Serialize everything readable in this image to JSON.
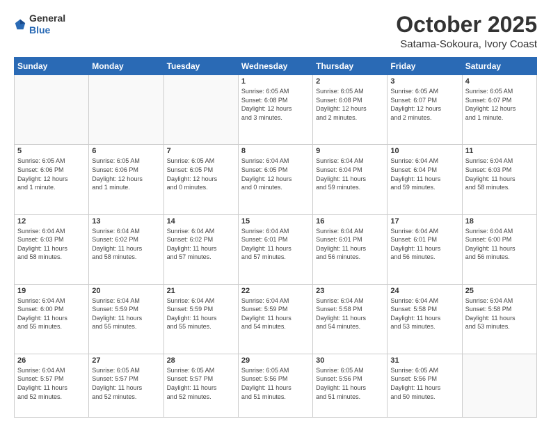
{
  "header": {
    "logo_general": "General",
    "logo_blue": "Blue",
    "month_title": "October 2025",
    "location": "Satama-Sokoura, Ivory Coast"
  },
  "days_of_week": [
    "Sunday",
    "Monday",
    "Tuesday",
    "Wednesday",
    "Thursday",
    "Friday",
    "Saturday"
  ],
  "weeks": [
    [
      {
        "day": "",
        "info": ""
      },
      {
        "day": "",
        "info": ""
      },
      {
        "day": "",
        "info": ""
      },
      {
        "day": "1",
        "info": "Sunrise: 6:05 AM\nSunset: 6:08 PM\nDaylight: 12 hours\nand 3 minutes."
      },
      {
        "day": "2",
        "info": "Sunrise: 6:05 AM\nSunset: 6:08 PM\nDaylight: 12 hours\nand 2 minutes."
      },
      {
        "day": "3",
        "info": "Sunrise: 6:05 AM\nSunset: 6:07 PM\nDaylight: 12 hours\nand 2 minutes."
      },
      {
        "day": "4",
        "info": "Sunrise: 6:05 AM\nSunset: 6:07 PM\nDaylight: 12 hours\nand 1 minute."
      }
    ],
    [
      {
        "day": "5",
        "info": "Sunrise: 6:05 AM\nSunset: 6:06 PM\nDaylight: 12 hours\nand 1 minute."
      },
      {
        "day": "6",
        "info": "Sunrise: 6:05 AM\nSunset: 6:06 PM\nDaylight: 12 hours\nand 1 minute."
      },
      {
        "day": "7",
        "info": "Sunrise: 6:05 AM\nSunset: 6:05 PM\nDaylight: 12 hours\nand 0 minutes."
      },
      {
        "day": "8",
        "info": "Sunrise: 6:04 AM\nSunset: 6:05 PM\nDaylight: 12 hours\nand 0 minutes."
      },
      {
        "day": "9",
        "info": "Sunrise: 6:04 AM\nSunset: 6:04 PM\nDaylight: 11 hours\nand 59 minutes."
      },
      {
        "day": "10",
        "info": "Sunrise: 6:04 AM\nSunset: 6:04 PM\nDaylight: 11 hours\nand 59 minutes."
      },
      {
        "day": "11",
        "info": "Sunrise: 6:04 AM\nSunset: 6:03 PM\nDaylight: 11 hours\nand 58 minutes."
      }
    ],
    [
      {
        "day": "12",
        "info": "Sunrise: 6:04 AM\nSunset: 6:03 PM\nDaylight: 11 hours\nand 58 minutes."
      },
      {
        "day": "13",
        "info": "Sunrise: 6:04 AM\nSunset: 6:02 PM\nDaylight: 11 hours\nand 58 minutes."
      },
      {
        "day": "14",
        "info": "Sunrise: 6:04 AM\nSunset: 6:02 PM\nDaylight: 11 hours\nand 57 minutes."
      },
      {
        "day": "15",
        "info": "Sunrise: 6:04 AM\nSunset: 6:01 PM\nDaylight: 11 hours\nand 57 minutes."
      },
      {
        "day": "16",
        "info": "Sunrise: 6:04 AM\nSunset: 6:01 PM\nDaylight: 11 hours\nand 56 minutes."
      },
      {
        "day": "17",
        "info": "Sunrise: 6:04 AM\nSunset: 6:01 PM\nDaylight: 11 hours\nand 56 minutes."
      },
      {
        "day": "18",
        "info": "Sunrise: 6:04 AM\nSunset: 6:00 PM\nDaylight: 11 hours\nand 56 minutes."
      }
    ],
    [
      {
        "day": "19",
        "info": "Sunrise: 6:04 AM\nSunset: 6:00 PM\nDaylight: 11 hours\nand 55 minutes."
      },
      {
        "day": "20",
        "info": "Sunrise: 6:04 AM\nSunset: 5:59 PM\nDaylight: 11 hours\nand 55 minutes."
      },
      {
        "day": "21",
        "info": "Sunrise: 6:04 AM\nSunset: 5:59 PM\nDaylight: 11 hours\nand 55 minutes."
      },
      {
        "day": "22",
        "info": "Sunrise: 6:04 AM\nSunset: 5:59 PM\nDaylight: 11 hours\nand 54 minutes."
      },
      {
        "day": "23",
        "info": "Sunrise: 6:04 AM\nSunset: 5:58 PM\nDaylight: 11 hours\nand 54 minutes."
      },
      {
        "day": "24",
        "info": "Sunrise: 6:04 AM\nSunset: 5:58 PM\nDaylight: 11 hours\nand 53 minutes."
      },
      {
        "day": "25",
        "info": "Sunrise: 6:04 AM\nSunset: 5:58 PM\nDaylight: 11 hours\nand 53 minutes."
      }
    ],
    [
      {
        "day": "26",
        "info": "Sunrise: 6:04 AM\nSunset: 5:57 PM\nDaylight: 11 hours\nand 52 minutes."
      },
      {
        "day": "27",
        "info": "Sunrise: 6:05 AM\nSunset: 5:57 PM\nDaylight: 11 hours\nand 52 minutes."
      },
      {
        "day": "28",
        "info": "Sunrise: 6:05 AM\nSunset: 5:57 PM\nDaylight: 11 hours\nand 52 minutes."
      },
      {
        "day": "29",
        "info": "Sunrise: 6:05 AM\nSunset: 5:56 PM\nDaylight: 11 hours\nand 51 minutes."
      },
      {
        "day": "30",
        "info": "Sunrise: 6:05 AM\nSunset: 5:56 PM\nDaylight: 11 hours\nand 51 minutes."
      },
      {
        "day": "31",
        "info": "Sunrise: 6:05 AM\nSunset: 5:56 PM\nDaylight: 11 hours\nand 50 minutes."
      },
      {
        "day": "",
        "info": ""
      }
    ]
  ]
}
